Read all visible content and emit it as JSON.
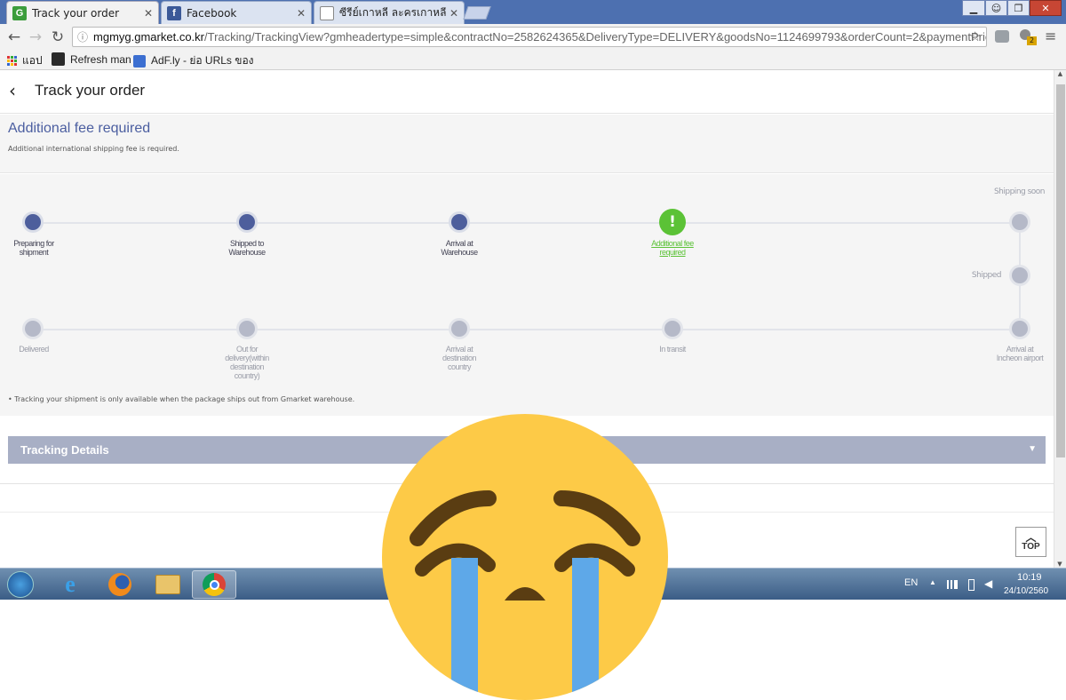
{
  "browser": {
    "tabs": [
      {
        "title": "Track your order",
        "favicon": "G",
        "favicon_color": "#3c9d3c"
      },
      {
        "title": "Facebook",
        "favicon": "f",
        "favicon_color": "#3b5998"
      },
      {
        "title": "ซีรีย์เกาหลี ละครเกาหลี ซีรีย์เ",
        "favicon": "doc",
        "favicon_color": "#ffffff"
      }
    ],
    "url_host": "mgmyg.gmarket.co.kr",
    "url_path": "/Tracking/TrackingView?gmheadertype=simple&contractNo=2582624365&DeliveryType=DELIVERY&goodsNo=1124699793&orderCount=2&paymentPrice...",
    "bookmarks": [
      {
        "label": "แอป",
        "icon": "apps-grid-icon"
      },
      {
        "label": "Refresh man",
        "icon": "refresh-man-icon"
      },
      {
        "label": "AdF.ly - ย่อ URLs ของ",
        "icon": "adfly-icon"
      }
    ],
    "extension_badge": "2"
  },
  "page": {
    "title": "Track your order",
    "alert_title": "Additional fee required",
    "alert_text": "Additional international shipping fee is required.",
    "shipping_soon": "Shipping soon",
    "steps_row1": [
      {
        "label_1": "Preparing for",
        "label_2": "shipment",
        "state": "done"
      },
      {
        "label_1": "Shipped to",
        "label_2": "Warehouse",
        "state": "done"
      },
      {
        "label_1": "Arrival at",
        "label_2": "Warehouse",
        "state": "done"
      },
      {
        "label_1": "Additional fee",
        "label_2": "required",
        "state": "warn"
      }
    ],
    "shipped_label": "Shipped",
    "steps_row2": [
      {
        "label_1": "Delivered",
        "label_2": "",
        "label_3": "",
        "label_4": ""
      },
      {
        "label_1": "Out for",
        "label_2": "delivery(within",
        "label_3": "destination",
        "label_4": "country)"
      },
      {
        "label_1": "Arrival at",
        "label_2": "destination",
        "label_3": "country",
        "label_4": ""
      },
      {
        "label_1": "In transit",
        "label_2": "",
        "label_3": "",
        "label_4": ""
      },
      {
        "label_1": "Arrival at",
        "label_2": "Incheon airport",
        "label_3": "",
        "label_4": ""
      }
    ],
    "note": "• Tracking your shipment is only available when the package ships out from Gmarket warehouse.",
    "tracking_details": "Tracking Details",
    "top_label": "TOP"
  },
  "taskbar": {
    "lang": "EN",
    "time": "10:19",
    "date": "24/10/2560"
  },
  "colors": {
    "done": "#4d5e9c",
    "todo": "#b5b9c8",
    "warn": "#5bc236",
    "title_blue": "#4b5ea0"
  }
}
